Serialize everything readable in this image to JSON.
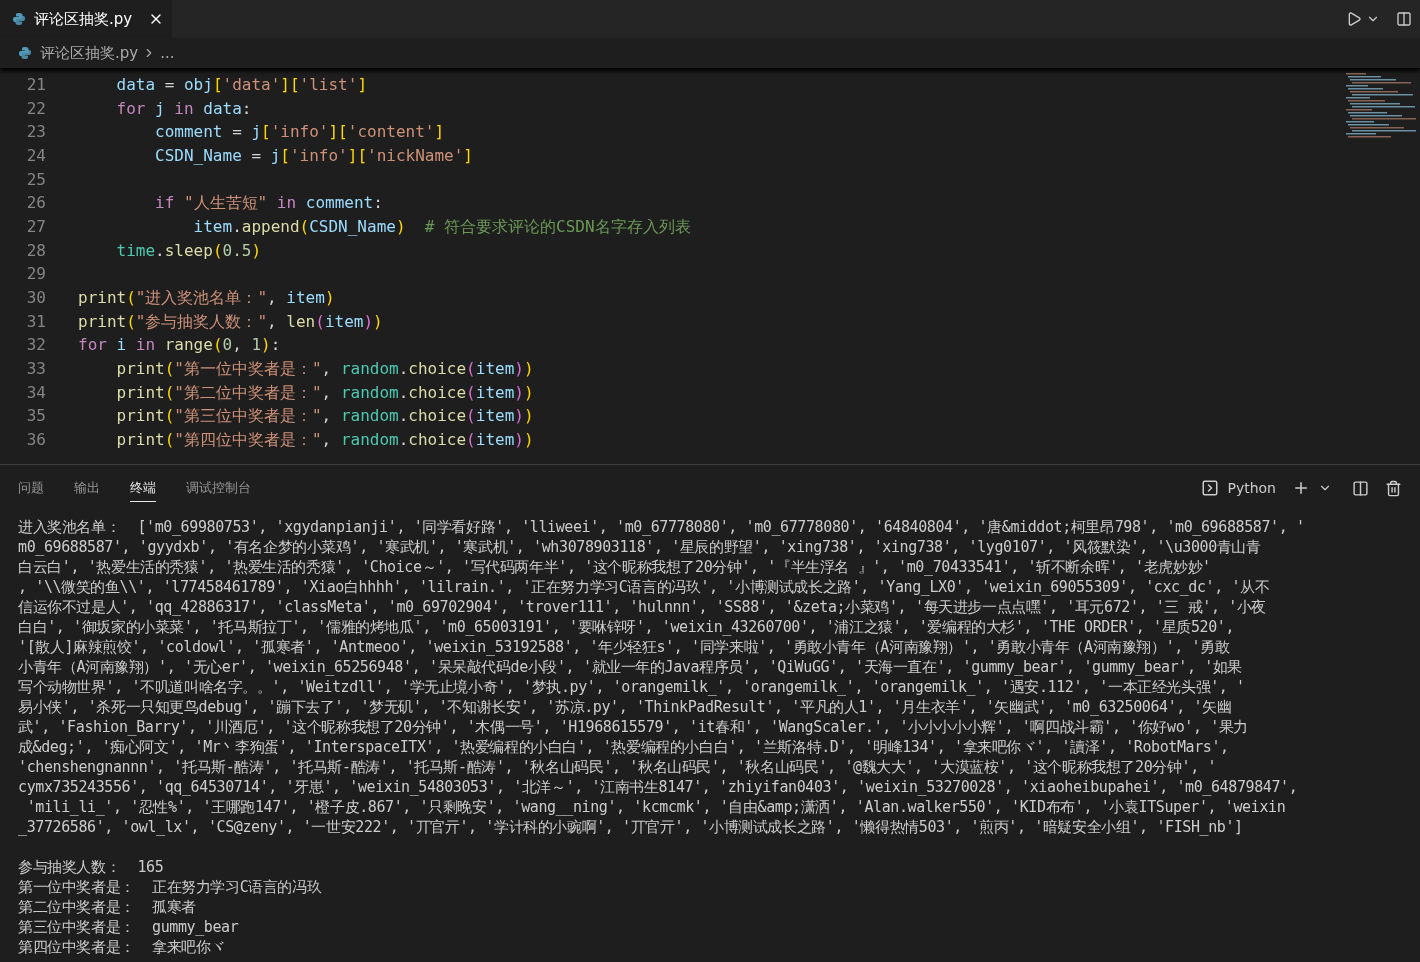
{
  "editor_tabs": [
    {
      "label": "评论区抽奖.py",
      "selected": true
    }
  ],
  "breadcrumb": {
    "file": "评论区抽奖.py",
    "rest": "..."
  },
  "code_lines": [
    {
      "number": "21",
      "tokens": [
        {
          "kind": "v",
          "text": "    data"
        },
        {
          "kind": "p",
          "text": " = "
        },
        {
          "kind": "v",
          "text": "obj"
        },
        {
          "kind": "b1",
          "text": "["
        },
        {
          "kind": "s",
          "text": "'data'"
        },
        {
          "kind": "b1",
          "text": "]["
        },
        {
          "kind": "s",
          "text": "'list'"
        },
        {
          "kind": "b1",
          "text": "]"
        }
      ]
    },
    {
      "number": "22",
      "tokens": [
        {
          "kind": "k",
          "text": "    for"
        },
        {
          "kind": "v",
          "text": " j"
        },
        {
          "kind": "k",
          "text": " in"
        },
        {
          "kind": "v",
          "text": " data"
        },
        {
          "kind": "p",
          "text": ":"
        }
      ]
    },
    {
      "number": "23",
      "tokens": [
        {
          "kind": "v",
          "text": "        comment"
        },
        {
          "kind": "p",
          "text": " = "
        },
        {
          "kind": "v",
          "text": "j"
        },
        {
          "kind": "b1",
          "text": "["
        },
        {
          "kind": "s",
          "text": "'info'"
        },
        {
          "kind": "b1",
          "text": "]["
        },
        {
          "kind": "s",
          "text": "'content'"
        },
        {
          "kind": "b1",
          "text": "]"
        }
      ]
    },
    {
      "number": "24",
      "tokens": [
        {
          "kind": "v",
          "text": "        CSDN_Name"
        },
        {
          "kind": "p",
          "text": " = "
        },
        {
          "kind": "v",
          "text": "j"
        },
        {
          "kind": "b1",
          "text": "["
        },
        {
          "kind": "s",
          "text": "'info'"
        },
        {
          "kind": "b1",
          "text": "]["
        },
        {
          "kind": "s",
          "text": "'nickName'"
        },
        {
          "kind": "b1",
          "text": "]"
        }
      ]
    },
    {
      "number": "25"
    },
    {
      "number": "26",
      "tokens": [
        {
          "kind": "k",
          "text": "        if"
        },
        {
          "kind": "s",
          "text": " \"人生苦短\""
        },
        {
          "kind": "k",
          "text": " in"
        },
        {
          "kind": "v",
          "text": " comment"
        },
        {
          "kind": "p",
          "text": ":"
        }
      ]
    },
    {
      "number": "27",
      "tokens": [
        {
          "kind": "v",
          "text": "            item"
        },
        {
          "kind": "p",
          "text": "."
        },
        {
          "kind": "f",
          "text": "append"
        },
        {
          "kind": "b1",
          "text": "("
        },
        {
          "kind": "v",
          "text": "CSDN_Name"
        },
        {
          "kind": "b1",
          "text": ")"
        },
        {
          "kind": "c",
          "text": "  # 符合要求评论的CSDN名字存入列表"
        }
      ]
    },
    {
      "number": "28",
      "tokens": [
        {
          "kind": "m",
          "text": "    time"
        },
        {
          "kind": "p",
          "text": "."
        },
        {
          "kind": "f",
          "text": "sleep"
        },
        {
          "kind": "b1",
          "text": "("
        },
        {
          "kind": "n",
          "text": "0.5"
        },
        {
          "kind": "b1",
          "text": ")"
        }
      ]
    },
    {
      "number": "29"
    },
    {
      "number": "30",
      "tokens": [
        {
          "kind": "f",
          "text": "print"
        },
        {
          "kind": "b1",
          "text": "("
        },
        {
          "kind": "s",
          "text": "\"进入奖池名单：\""
        },
        {
          "kind": "p",
          "text": ", "
        },
        {
          "kind": "v",
          "text": "item"
        },
        {
          "kind": "b1",
          "text": ")"
        }
      ]
    },
    {
      "number": "31",
      "tokens": [
        {
          "kind": "f",
          "text": "print"
        },
        {
          "kind": "b1",
          "text": "("
        },
        {
          "kind": "s",
          "text": "\"参与抽奖人数：\""
        },
        {
          "kind": "p",
          "text": ", "
        },
        {
          "kind": "f",
          "text": "len"
        },
        {
          "kind": "b2",
          "text": "("
        },
        {
          "kind": "v",
          "text": "item"
        },
        {
          "kind": "b2",
          "text": ")"
        },
        {
          "kind": "b1",
          "text": ")"
        }
      ]
    },
    {
      "number": "32",
      "tokens": [
        {
          "kind": "k",
          "text": "for"
        },
        {
          "kind": "v",
          "text": " i"
        },
        {
          "kind": "k",
          "text": " in"
        },
        {
          "kind": "f",
          "text": " range"
        },
        {
          "kind": "b1",
          "text": "("
        },
        {
          "kind": "n",
          "text": "0"
        },
        {
          "kind": "p",
          "text": ", "
        },
        {
          "kind": "n",
          "text": "1"
        },
        {
          "kind": "b1",
          "text": ")"
        },
        {
          "kind": "p",
          "text": ":"
        }
      ]
    },
    {
      "number": "33",
      "tokens": [
        {
          "kind": "f",
          "text": "    print"
        },
        {
          "kind": "b1",
          "text": "("
        },
        {
          "kind": "s",
          "text": "\"第一位中奖者是：\""
        },
        {
          "kind": "p",
          "text": ", "
        },
        {
          "kind": "m",
          "text": "random"
        },
        {
          "kind": "p",
          "text": "."
        },
        {
          "kind": "f",
          "text": "choice"
        },
        {
          "kind": "b2",
          "text": "("
        },
        {
          "kind": "v",
          "text": "item"
        },
        {
          "kind": "b2",
          "text": ")"
        },
        {
          "kind": "b1",
          "text": ")"
        }
      ]
    },
    {
      "number": "34",
      "tokens": [
        {
          "kind": "f",
          "text": "    print"
        },
        {
          "kind": "b1",
          "text": "("
        },
        {
          "kind": "s",
          "text": "\"第二位中奖者是：\""
        },
        {
          "kind": "p",
          "text": ", "
        },
        {
          "kind": "m",
          "text": "random"
        },
        {
          "kind": "p",
          "text": "."
        },
        {
          "kind": "f",
          "text": "choice"
        },
        {
          "kind": "b2",
          "text": "("
        },
        {
          "kind": "v",
          "text": "item"
        },
        {
          "kind": "b2",
          "text": ")"
        },
        {
          "kind": "b1",
          "text": ")"
        }
      ]
    },
    {
      "number": "35",
      "tokens": [
        {
          "kind": "f",
          "text": "    print"
        },
        {
          "kind": "b1",
          "text": "("
        },
        {
          "kind": "s",
          "text": "\"第三位中奖者是：\""
        },
        {
          "kind": "p",
          "text": ", "
        },
        {
          "kind": "m",
          "text": "random"
        },
        {
          "kind": "p",
          "text": "."
        },
        {
          "kind": "f",
          "text": "choice"
        },
        {
          "kind": "b2",
          "text": "("
        },
        {
          "kind": "v",
          "text": "item"
        },
        {
          "kind": "b2",
          "text": ")"
        },
        {
          "kind": "b1",
          "text": ")"
        }
      ]
    },
    {
      "number": "36",
      "tokens": [
        {
          "kind": "f",
          "text": "    print"
        },
        {
          "kind": "b1",
          "text": "("
        },
        {
          "kind": "s",
          "text": "\"第四位中奖者是：\""
        },
        {
          "kind": "p",
          "text": ", "
        },
        {
          "kind": "m",
          "text": "random"
        },
        {
          "kind": "p",
          "text": "."
        },
        {
          "kind": "f",
          "text": "choice"
        },
        {
          "kind": "b2",
          "text": "("
        },
        {
          "kind": "v",
          "text": "item"
        },
        {
          "kind": "b2",
          "text": ")"
        },
        {
          "kind": "b1",
          "text": ")"
        }
      ]
    }
  ],
  "panel": {
    "tabs": [
      {
        "label": "问题",
        "selected": false
      },
      {
        "label": "输出",
        "selected": false
      },
      {
        "label": "终端",
        "selected": true
      },
      {
        "label": "调试控制台",
        "selected": false
      }
    ],
    "shell": "Python"
  },
  "terminal": {
    "lines": [
      "进入奖池名单：  ['m0_69980753', 'xgydanpianji', '同学看好路', 'lliweei', 'm0_67778080', 'm0_67778080', '64840804', '唐&middot;柯里昂798', 'm0_69688587', '",
      "m0_69688587', 'gyydxb', '有名企梦的小菜鸡', '寒武机', '寒武机', 'wh3078903118', '星辰的野望', 'xing738', 'xing738', 'lyg0107', '风筱默染', '\\u3000青山青",
      "白云白', '热爱生活的秃猿', '热爱生活的秃猿', 'Choice～', '写代码两年半', '这个昵称我想了20分钟', '『半生浮名 』', 'm0_70433541', '斩不断余晖', '老虎妙妙'",
      ", '\\\\微笑的鱼\\\\', 'l77458461789', 'Xiao白hhhh', 'lilrain.', '正在努力学习C语言的冯玖', '小博测试成长之路', 'Yang_LX0', 'weixin_69055309', 'cxc_dc', '从不",
      "信运你不过是人', 'qq_42886317', 'classMeta', 'm0_69702904', 'trover111', 'hulnnn', 'SS88', '&zeta;小菜鸡', '每天进步一点点嘿', '耳元672', '三 戒', '小夜",
      "白白', '御坂家的小菜菜', '托马斯拉丁', '儒雅的烤地瓜', 'm0_65003191', '要咻锌呀', 'weixin_43260700', '浦江之猿', '爱编程的大杉', 'THE ORDER', '星质520',",
      "'[散人]麻辣煎饺', 'coldowl', '孤寒者', 'Antmeoo', 'weixin_53192588', '年少轻狂s', '同学来啦', '勇敢小青年（A河南豫翔）', '勇敢小青年（A河南豫翔）', '勇敢",
      "小青年（A河南豫翔）', '无心er', 'weixin_65256948', '呆呆敲代码de小段', '就业一年的Java程序员', 'QiWuGG', '天海一直在', 'gummy_bear', 'gummy_bear', '如果",
      "写个动物世界', '不叽道叫啥名字。。', 'Weitzdll', '学无止境小奇', '梦执.py', 'orangemilk_', 'orangemilk_', 'orangemilk_', '遇安.112', '一本正经光头强', '",
      "易小侠', '杀死一只知更鸟debug', '蹦下去了', '梦无矶', '不知谢长安', '苏凉.py', 'ThinkPadResult', '平凡的人1', '月生衣羊', '矢幽武', 'm0_63250064', '矢幽",
      "武', 'Fashion_Barry', '川酒厄', '这个昵称我想了20分钟', '木偶一号', 'H1968615579', 'it春和', 'WangScaler.', '小小小小小辉', '啊四战斗霸', '你好wo', '果力",
      "成&deg;', '痴心阿文', 'Mr丶李狗蛋', 'InterspaceITX', '热爱编程的小白白', '热爱编程的小白白', '兰斯洛特.D', '明峰134', '拿来吧你ヾ', '讀泽', 'RobotMars',",
      "'chenshengnannn', '托马斯-酷涛', '托马斯-酷涛', '托马斯-酷涛', '秋名山码民', '秋名山码民', '秋名山码民', '@魏大大', '大漠蓝桉', '这个昵称我想了20分钟', '",
      "cymx735243556', 'qq_64530714', '牙崽', 'weixin_54803053', '北洋～', '江南书生8147', 'zhiyifan0403', 'weixin_53270028', 'xiaoheibupahei', 'm0_64879847',",
      " 'mili_li_', '忍性%', '王哪跑147', '橙子皮.867', '只剩晚安', 'wang__ning', 'kcmcmk', '自由&amp;潇洒', 'Alan.walker550', 'KID布布', '小袁ITSuper', 'weixin",
      "_37726586', 'owl_lx', 'CS@zeny', '一世安222', '丌官亓', '学计科的小豌啊', '丌官亓', '小博测试成长之路', '懒得热情503', '煎丙', '暗疑安全小组', 'FISH_nb']"
    ],
    "result_lines": [
      "参与抽奖人数：  165",
      "第一位中奖者是：  正在努力学习C语言的冯玖",
      "第二位中奖者是：  孤寒者",
      "第三位中奖者是：  gummy_bear",
      "第四位中奖者是：  拿来吧你ヾ"
    ]
  }
}
